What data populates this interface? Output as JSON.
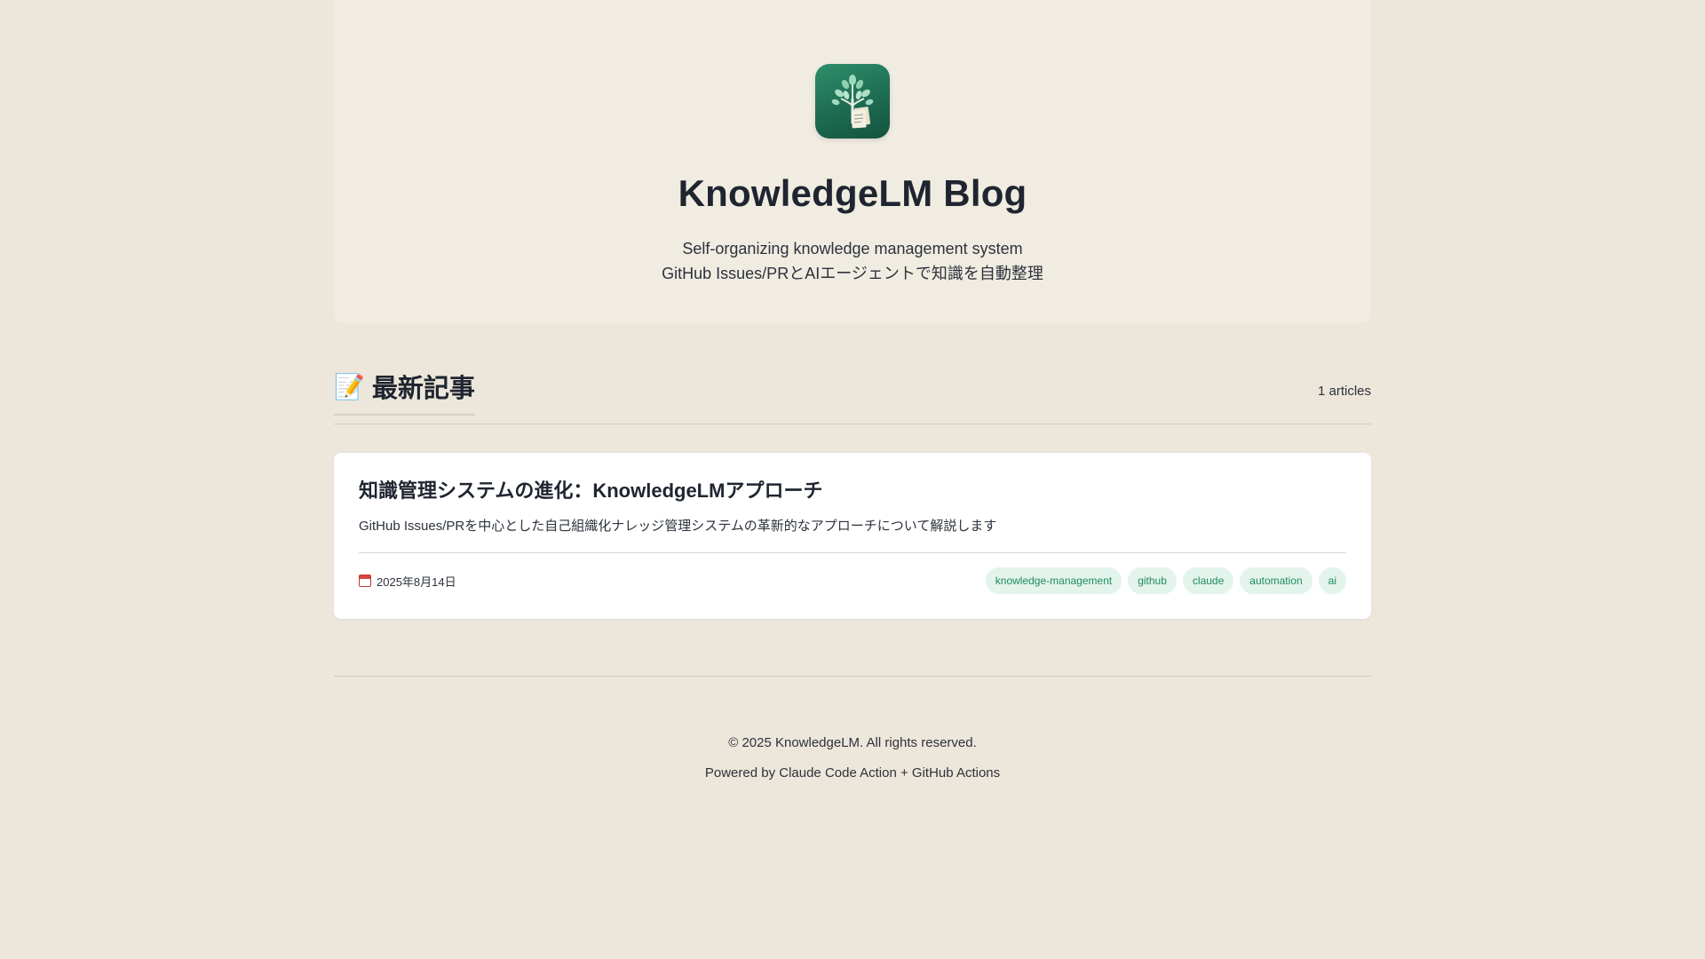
{
  "header": {
    "logo_icon": "knowledge-tree-icon",
    "title": "KnowledgeLM Blog",
    "subtitle_en": "Self-organizing knowledge management system",
    "subtitle_ja": "GitHub Issues/PRとAIエージェントで知識を自動整理"
  },
  "section": {
    "emoji": "📝",
    "title": "最新記事",
    "count": "1 articles"
  },
  "articles": [
    {
      "title": "知識管理システムの進化：KnowledgeLMアプローチ",
      "description": "GitHub Issues/PRを中心とした自己組織化ナレッジ管理システムの革新的なアプローチについて解説します",
      "date": "2025年8月14日",
      "tags": [
        "knowledge-management",
        "github",
        "claude",
        "automation",
        "ai"
      ]
    }
  ],
  "footer": {
    "copyright": "© 2025 KnowledgeLM. All rights reserved.",
    "powered": "Powered by Claude Code Action + GitHub Actions"
  },
  "colors": {
    "background": "#ede6da",
    "accent": "#1f8a63",
    "tag_bg": "#e3f4ec"
  }
}
